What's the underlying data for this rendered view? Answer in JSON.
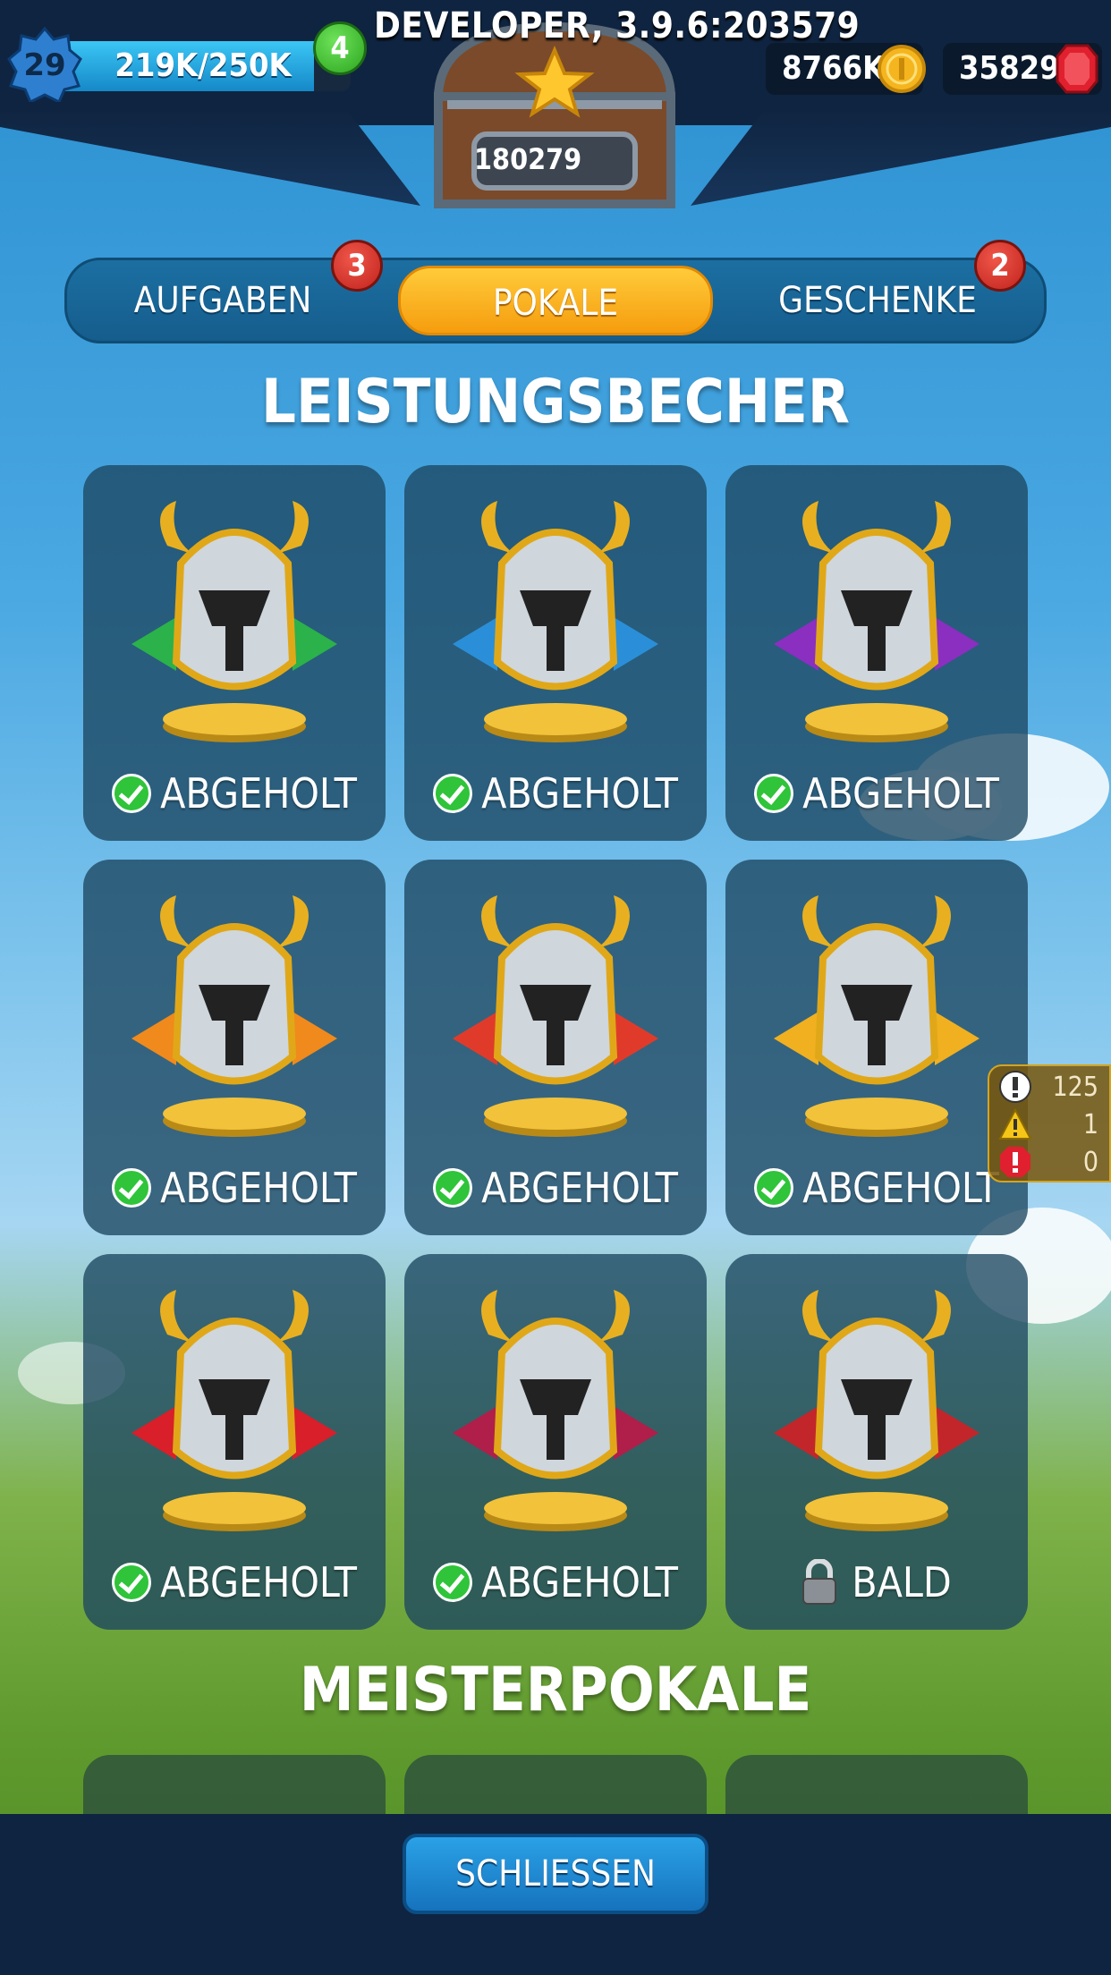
{
  "header": {
    "level": "29",
    "xp_text": "219K/250K",
    "xp_progress": 0.876,
    "notification_count": "4",
    "developer_text": "DEVELOPER, 3.9.6:203579",
    "chest_count": "180279",
    "coins": "8766K",
    "gems": "35829"
  },
  "tabs": [
    {
      "label": "AUFGABEN",
      "badge": "3",
      "active": false
    },
    {
      "label": "POKALE",
      "badge": "",
      "active": true
    },
    {
      "label": "GESCHENKE",
      "badge": "2",
      "active": false
    }
  ],
  "sections": {
    "achievement_title": "LEISTUNGSBECHER",
    "master_title": "MEISTERPOKALE"
  },
  "trophies": [
    {
      "status": "ABGEHOLT",
      "accent": "#2bb24a",
      "icon": "horned-knight-helmet-icon"
    },
    {
      "status": "ABGEHOLT",
      "accent": "#2a8fd8",
      "icon": "golden-crest-helmet-icon"
    },
    {
      "status": "ABGEHOLT",
      "accent": "#8a2fc0",
      "icon": "winged-helmet-icon"
    },
    {
      "status": "ABGEHOLT",
      "accent": "#f08a1c",
      "icon": "spartan-helmet-icon"
    },
    {
      "status": "ABGEHOLT",
      "accent": "#e03b2a",
      "icon": "lion-helmet-icon"
    },
    {
      "status": "ABGEHOLT",
      "accent": "#f0b020",
      "icon": "dragon-helmet-icon"
    },
    {
      "status": "ABGEHOLT",
      "accent": "#d81f2a",
      "icon": "chained-shield-icon"
    },
    {
      "status": "ABGEHOLT",
      "accent": "#b01e4a",
      "icon": "eagle-crest-icon"
    },
    {
      "status": "BALD",
      "accent": "#c2262a",
      "icon": "demon-mask-icon"
    }
  ],
  "warnings": {
    "info": "125",
    "warning": "1",
    "error": "0"
  },
  "footer": {
    "close_label": "SCHLIESSEN"
  }
}
